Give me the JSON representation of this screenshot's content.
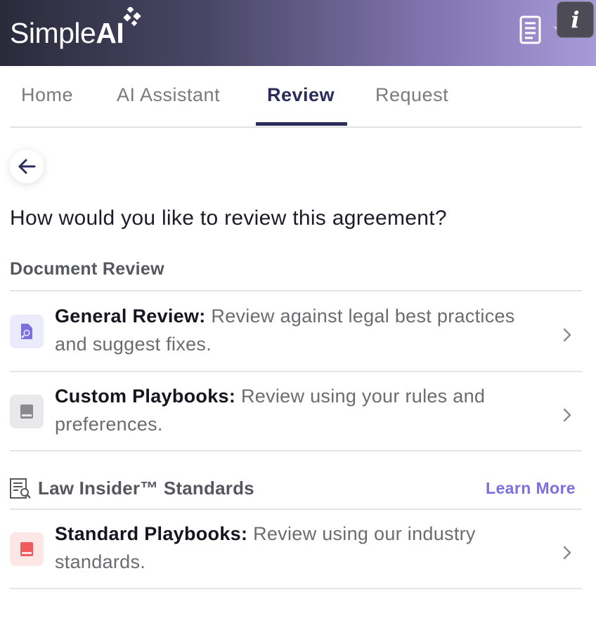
{
  "header": {
    "logo_text_simple": "Simple",
    "logo_text_ai": "AI",
    "info_label": "i",
    "gradient_colors": [
      "#2b2a3b",
      "#a79ad8"
    ]
  },
  "tabs": [
    {
      "label": "Home",
      "active": false
    },
    {
      "label": "AI Assistant",
      "active": false
    },
    {
      "label": "Review",
      "active": true
    },
    {
      "label": "Request",
      "active": false
    }
  ],
  "main": {
    "question": "How would you like to review this agreement?",
    "document_review": {
      "title": "Document Review",
      "options": [
        {
          "title": "General Review:",
          "description": " Review against legal best practices and suggest fixes.",
          "icon": "document-search-icon",
          "icon_color": "#7c6fe0"
        },
        {
          "title": "Custom Playbooks:",
          "description": " Review using your rules and preferences.",
          "icon": "book-icon",
          "icon_color": "#8a8a90"
        }
      ]
    },
    "law_insider": {
      "title": "Law Insider™ Standards",
      "learn_more": "Learn More",
      "options": [
        {
          "title": "Standard Playbooks:",
          "description": " Review using our industry standards.",
          "icon": "book-icon",
          "icon_color": "#ef5a5a"
        }
      ]
    }
  },
  "colors": {
    "accent": "#2b2c5a",
    "link": "#7c6fe0"
  }
}
